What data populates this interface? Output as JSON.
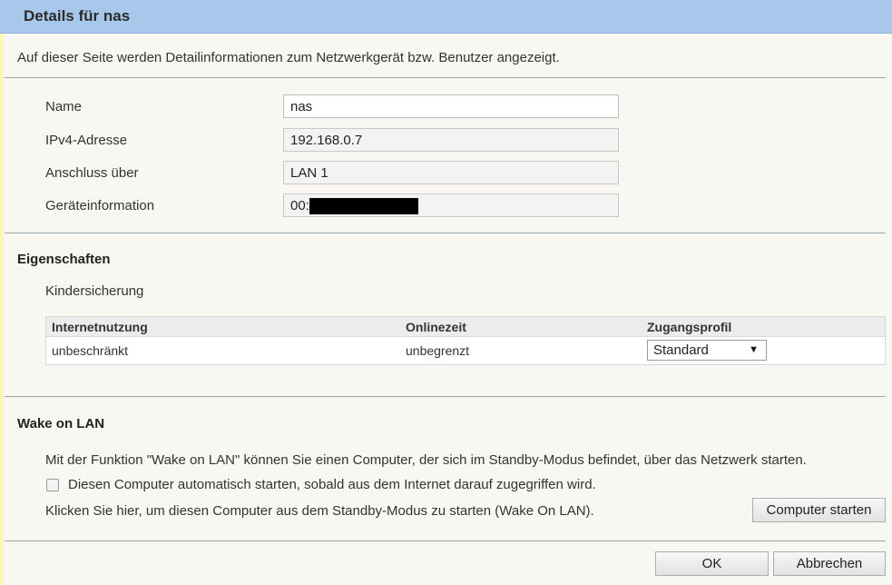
{
  "dialog": {
    "title": "Details für nas",
    "intro": "Auf dieser Seite werden Detailinformationen zum Netzwerkgerät bzw. Benutzer angezeigt."
  },
  "fields": {
    "name_label": "Name",
    "name_value": "nas",
    "ipv4_label": "IPv4-Adresse",
    "ipv4_value": "192.168.0.7",
    "connection_label": "Anschluss über",
    "connection_value": "LAN 1",
    "device_info_label": "Geräteinformation",
    "device_info_value": "00:"
  },
  "properties": {
    "heading": "Eigenschaften",
    "parental_control": "Kindersicherung",
    "table": {
      "headers": [
        "Internetnutzung",
        "Onlinezeit",
        "Zugangsprofil"
      ],
      "row": {
        "internet_usage": "unbeschränkt",
        "online_time": "unbegrenzt",
        "access_profile": "Standard"
      }
    }
  },
  "wol": {
    "heading": "Wake on LAN",
    "description": "Mit der Funktion \"Wake on LAN\" können Sie einen Computer, der sich im Standby-Modus befindet, über das Netzwerk starten.",
    "checkbox_label": "Diesen Computer automatisch starten, sobald aus dem Internet darauf zugegriffen wird.",
    "checkbox_checked": false,
    "start_text": "Klicken Sie hier, um diesen Computer aus dem Standby-Modus zu starten (Wake On LAN).",
    "start_button": "Computer starten"
  },
  "footer": {
    "ok": "OK",
    "cancel": "Abbrechen"
  }
}
